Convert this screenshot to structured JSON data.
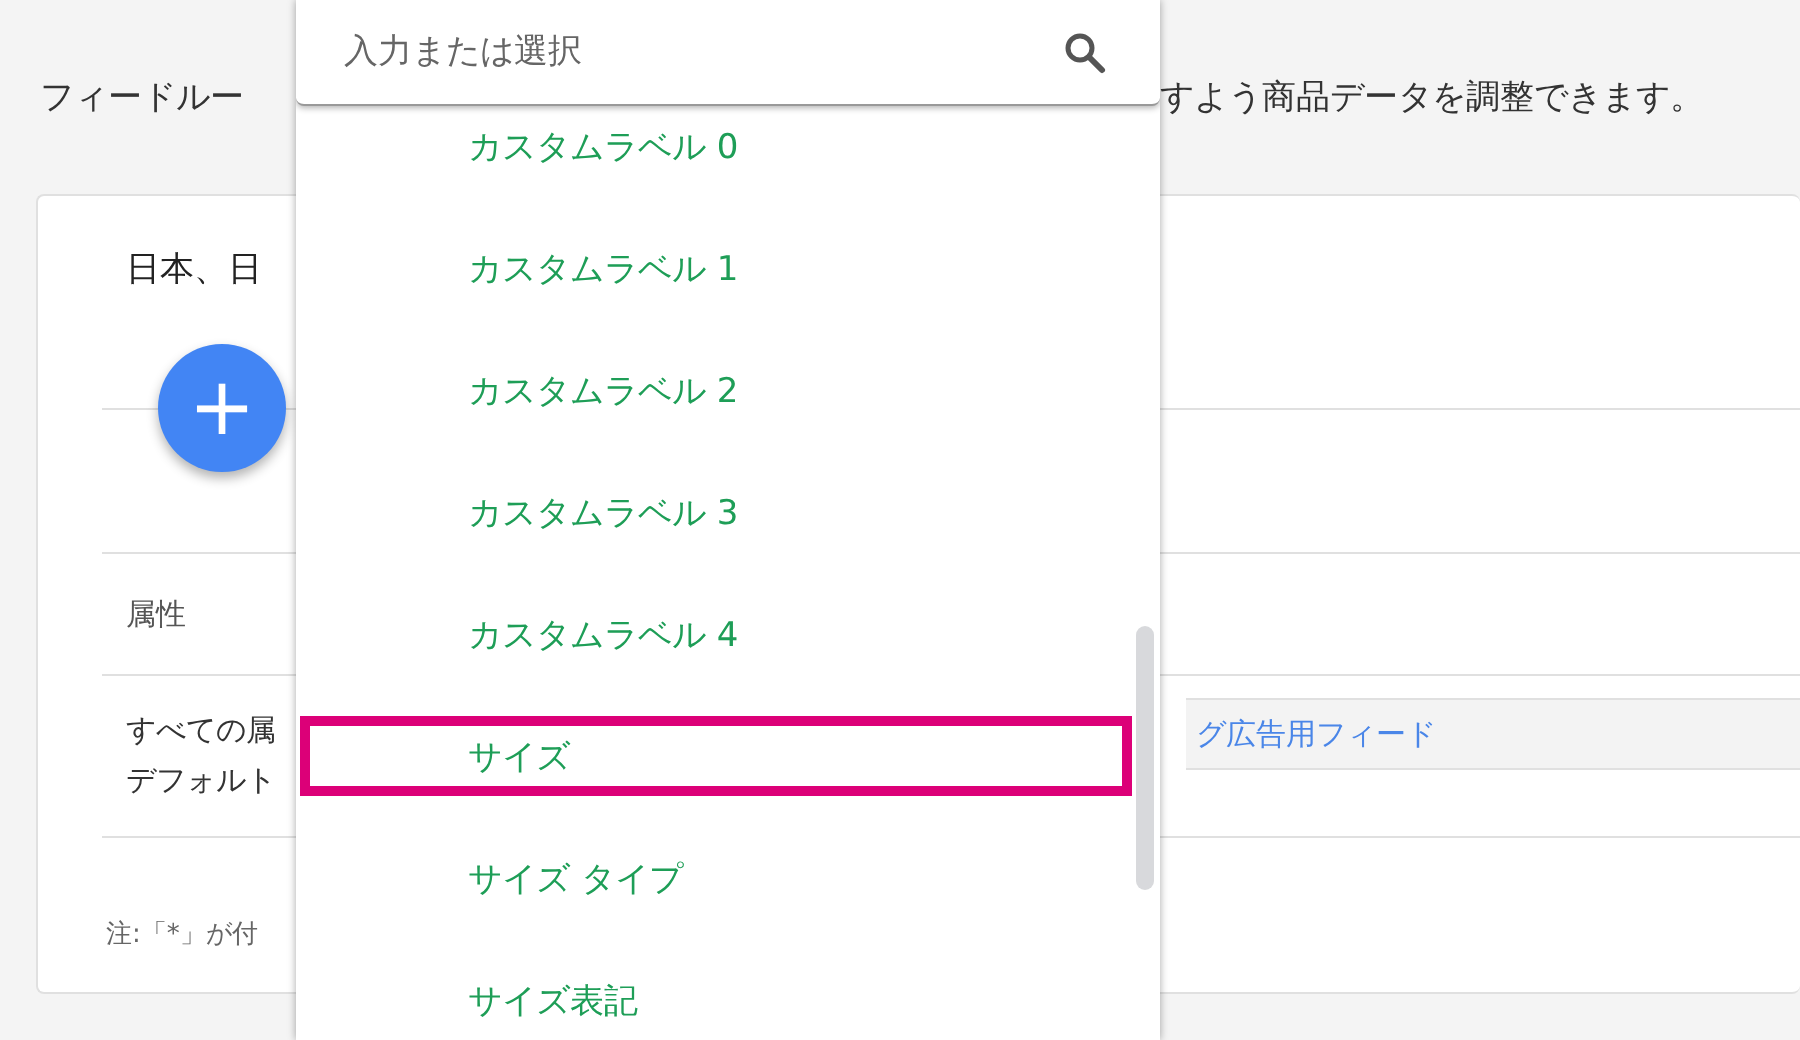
{
  "page": {
    "description_start": "フィードルー",
    "description_end": "すよう商品データを調整できます。"
  },
  "card": {
    "title": "日本、日",
    "add_button": "+",
    "attribute_header": "属性",
    "row_lines": [
      "すべての属",
      "デフォルト"
    ],
    "feed_link": "グ広告用フィード",
    "note": "注:「*」が付"
  },
  "dropdown": {
    "search": {
      "placeholder": "入力または選択"
    },
    "items": [
      {
        "label": "カスタムラベル 0",
        "highlighted": false
      },
      {
        "label": "カスタムラベル 1",
        "highlighted": false
      },
      {
        "label": "カスタムラベル 2",
        "highlighted": false
      },
      {
        "label": "カスタムラベル 3",
        "highlighted": false
      },
      {
        "label": "カスタムラベル 4",
        "highlighted": false
      },
      {
        "label": "サイズ",
        "highlighted": true
      },
      {
        "label": "サイズ タイプ",
        "highlighted": false
      },
      {
        "label": "サイズ表記",
        "highlighted": false
      }
    ]
  }
}
